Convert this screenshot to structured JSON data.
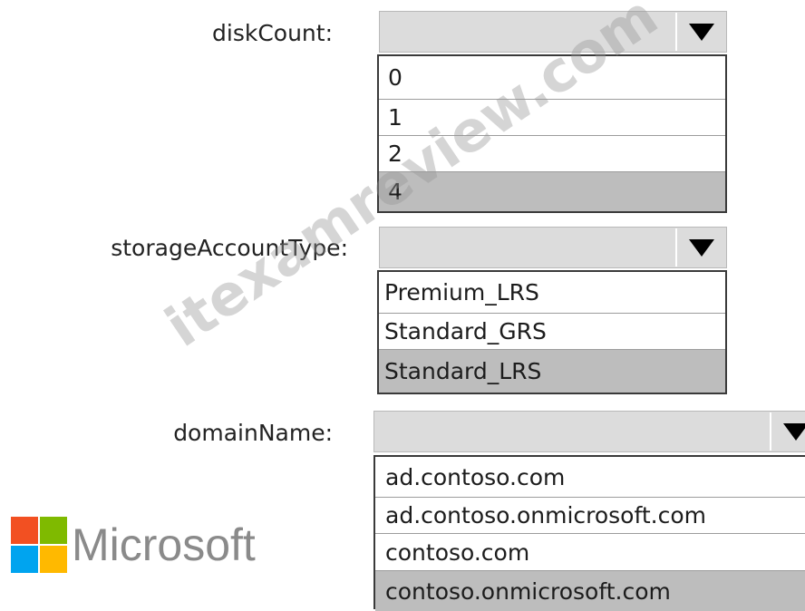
{
  "fields": [
    {
      "label": "diskCount:",
      "selected_value": "",
      "arrow_icon": "triangle-down-icon",
      "options": [
        "0",
        "1",
        "2",
        "4"
      ],
      "highlighted_option": "4"
    },
    {
      "label": "storageAccountType:",
      "selected_value": "",
      "arrow_icon": "triangle-down-icon",
      "options": [
        "Premium_LRS",
        "Standard_GRS",
        "Standard_LRS"
      ],
      "highlighted_option": "Standard_LRS"
    },
    {
      "label": "domainName:",
      "selected_value": "",
      "arrow_icon": "triangle-down-icon",
      "options": [
        "ad.contoso.com",
        "ad.contoso.onmicrosoft.com",
        "contoso.com",
        "contoso.onmicrosoft.com"
      ],
      "highlighted_option": "contoso.onmicrosoft.com"
    }
  ],
  "logo": {
    "text": "Microsoft",
    "colors": [
      "#f25022",
      "#7fba00",
      "#00a4ef",
      "#ffb900"
    ]
  },
  "watermark": "itexamreview.com",
  "colors": {
    "combo_fill": "#dcdcdc",
    "highlight_fill": "#bdbdbd",
    "border": "#3a3a3a"
  }
}
